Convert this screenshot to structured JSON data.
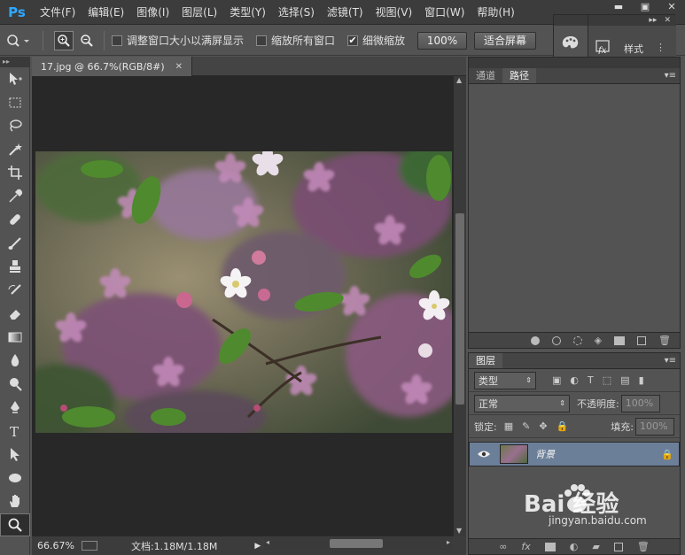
{
  "app": {
    "logo": "Ps",
    "menu": [
      "文件(F)",
      "编辑(E)",
      "图像(I)",
      "图层(L)",
      "类型(Y)",
      "选择(S)",
      "滤镜(T)",
      "视图(V)",
      "窗口(W)",
      "帮助(H)"
    ]
  },
  "options": {
    "resize_windows": "调整窗口大小以满屏显示",
    "zoom_all": "缩放所有窗口",
    "scrubby_zoom": "细微缩放",
    "scrubby_checked": true,
    "zoom_100": "100%",
    "fit_screen": "适合屏幕"
  },
  "float_panel": {
    "styles_label": "样式"
  },
  "document": {
    "tab_title": "17.jpg @ 66.7%(RGB/8#)",
    "zoom": "66.67%",
    "doc_info": "文档:1.18M/1.18M"
  },
  "paths_panel": {
    "tabs": [
      "通道",
      "路径"
    ],
    "active_tab": "路径"
  },
  "layers_panel": {
    "title": "图层",
    "filter_kind": "类型",
    "blend_mode": "正常",
    "opacity_label": "不透明度:",
    "opacity_value": "100%",
    "lock_label": "锁定:",
    "fill_label": "填充:",
    "fill_value": "100%",
    "layers": [
      {
        "name": "背景",
        "visible": true,
        "locked": true
      }
    ]
  },
  "watermark": {
    "brand": "Bai 经验",
    "url": "jingyan.baidu.com"
  },
  "colors": {
    "accent_blue": "#2fa8ff",
    "selected_layer": "#6c7f99",
    "panel_bg": "#535353",
    "canvas_bg": "#282828"
  }
}
